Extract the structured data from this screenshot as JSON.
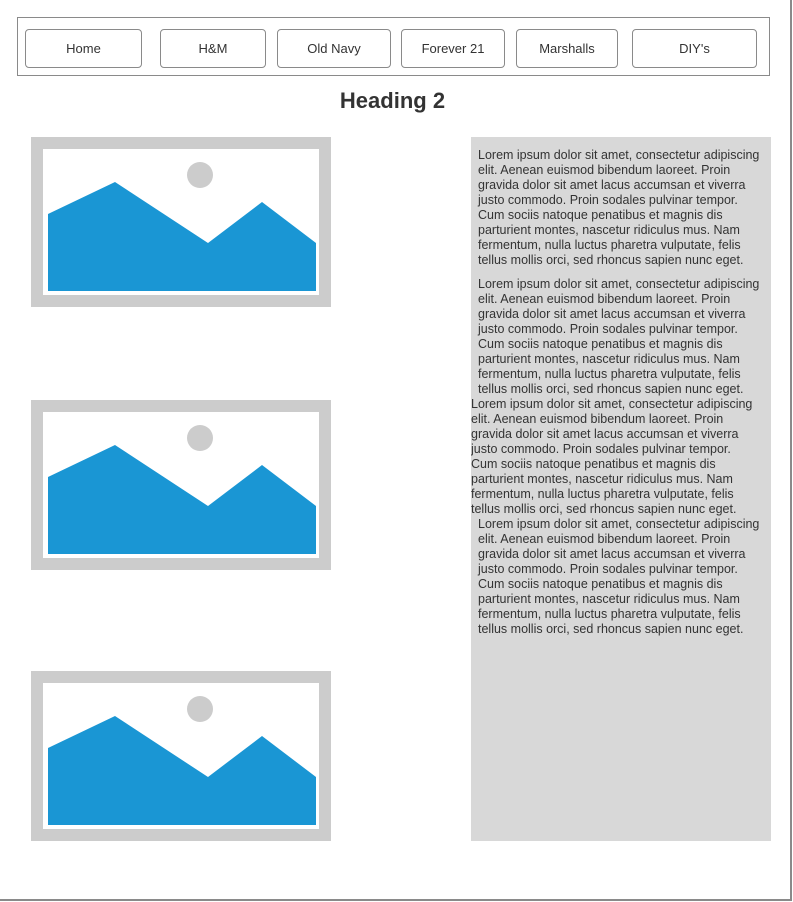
{
  "nav": {
    "items": [
      {
        "label": "Home"
      },
      {
        "label": "H&M"
      },
      {
        "label": "Old Navy"
      },
      {
        "label": "Forever 21"
      },
      {
        "label": "Marshalls"
      },
      {
        "label": "DIY's"
      }
    ]
  },
  "main": {
    "heading": "Heading 2",
    "images": [
      {
        "icon": "image-placeholder-icon"
      },
      {
        "icon": "image-placeholder-icon"
      },
      {
        "icon": "image-placeholder-icon"
      }
    ],
    "paragraphs": [
      {
        "text": "Lorem ipsum dolor sit amet, consectetur adipiscing\nelit. Aenean euismod bibendum laoreet. Proin\ngravida dolor sit amet lacus accumsan et viverra\njusto commodo. Proin sodales pulvinar tempor.\nCum sociis natoque penatibus et magnis dis\nparturient montes, nascetur ridiculus mus. Nam\nfermentum, nulla luctus pharetra vulputate, felis\ntellus mollis orci, sed rhoncus sapien nunc eget."
      },
      {
        "text": "Lorem ipsum dolor sit amet, consectetur adipiscing\nelit. Aenean euismod bibendum laoreet. Proin\ngravida dolor sit amet lacus accumsan et viverra\njusto commodo. Proin sodales pulvinar tempor.\nCum sociis natoque penatibus et magnis dis\nparturient montes, nascetur ridiculus mus. Nam\nfermentum, nulla luctus pharetra vulputate, felis\ntellus mollis orci, sed rhoncus sapien nunc eget."
      },
      {
        "text": "Lorem ipsum dolor sit amet, consectetur adipiscing\nelit. Aenean euismod bibendum laoreet. Proin\ngravida dolor sit amet lacus accumsan et viverra\njusto commodo. Proin sodales pulvinar tempor.\nCum sociis natoque penatibus et magnis dis\nparturient montes, nascetur ridiculus mus. Nam\nfermentum, nulla luctus pharetra vulputate, felis\ntellus mollis orci, sed rhoncus sapien nunc eget."
      },
      {
        "text": "Lorem ipsum dolor sit amet, consectetur adipiscing\nelit. Aenean euismod bibendum laoreet. Proin\ngravida dolor sit amet lacus accumsan et viverra\njusto commodo. Proin sodales pulvinar tempor.\nCum sociis natoque penatibus et magnis dis\nparturient montes, nascetur ridiculus mus. Nam\nfermentum, nulla luctus pharetra vulputate, felis\ntellus mollis orci, sed rhoncus sapien nunc eget."
      }
    ]
  },
  "colors": {
    "image_fill": "#1a96d4",
    "image_frame": "#cccccc",
    "panel_background": "#d8d8d8"
  }
}
